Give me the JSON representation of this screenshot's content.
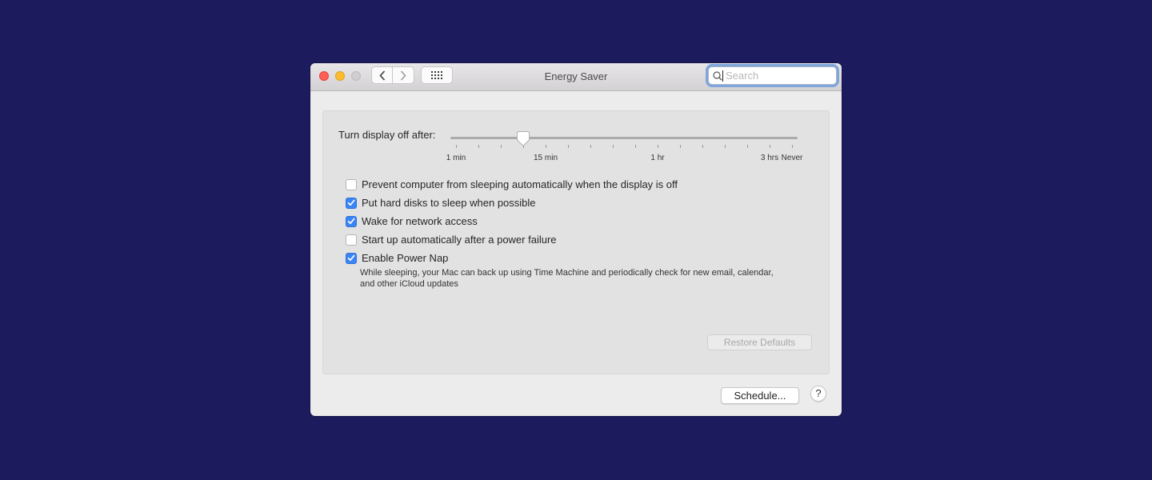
{
  "window": {
    "title": "Energy Saver",
    "search": {
      "placeholder": "Search",
      "value": ""
    },
    "toolbar": {
      "back_icon": "chevron-left-icon",
      "forward_icon": "chevron-right-icon",
      "show_all_icon": "grid-icon"
    }
  },
  "slider": {
    "label": "Turn display off after:",
    "tick_count": 16,
    "selected_tick_index": 3,
    "tick_labels": [
      {
        "text": "1 min",
        "tick": 0
      },
      {
        "text": "15 min",
        "tick": 4
      },
      {
        "text": "1 hr",
        "tick": 9
      },
      {
        "text": "3 hrs",
        "tick": 14
      },
      {
        "text": "Never",
        "tick": 15
      }
    ]
  },
  "options": [
    {
      "label": "Prevent computer from sleeping automatically when the display is off",
      "checked": false
    },
    {
      "label": "Put hard disks to sleep when possible",
      "checked": true
    },
    {
      "label": "Wake for network access",
      "checked": true
    },
    {
      "label": "Start up automatically after a power failure",
      "checked": false
    },
    {
      "label": "Enable Power Nap",
      "checked": true
    }
  ],
  "power_nap_description": "While sleeping, your Mac can back up using Time Machine and periodically check for new email, calendar, and other iCloud updates",
  "buttons": {
    "restore_defaults": "Restore Defaults",
    "schedule": "Schedule...",
    "help": "?"
  },
  "colors": {
    "accent": "#3a85f5",
    "desktop": "#1c1b5e"
  }
}
